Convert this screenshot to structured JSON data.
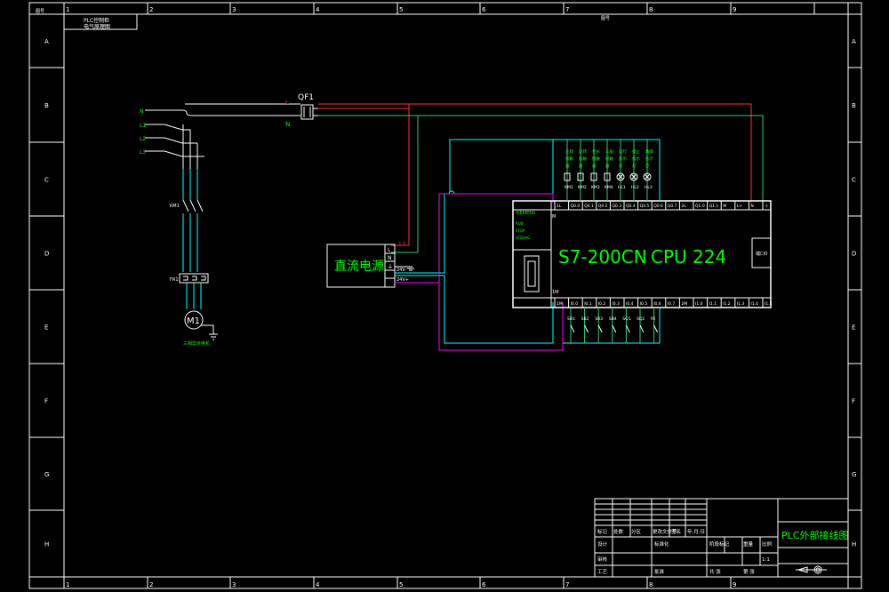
{
  "frame": {
    "top_cols": [
      "1",
      "2",
      "3",
      "4",
      "5",
      "6",
      "7",
      "8",
      "9"
    ],
    "rows": [
      "A",
      "B",
      "C",
      "D",
      "E",
      "F",
      "G",
      "H"
    ],
    "corner_tl": "图号",
    "corner_tr": "图号"
  },
  "title_box": {
    "line1": "PLC控制柜",
    "line2": "电气原理图"
  },
  "supply": {
    "phases": [
      "N",
      "L1",
      "L2",
      "L3"
    ],
    "breaker": "QF1",
    "l_label": "L",
    "n_label": "N"
  },
  "motor": {
    "km_label": "KM1",
    "fr_label": "FR1",
    "symbol": "M1",
    "caption": "三相异步电机"
  },
  "dc_supply": {
    "title": "直流电源",
    "terminals": [
      "L",
      "N",
      "⏚",
      "24V-",
      "24V+"
    ],
    "plus_label": "L1"
  },
  "plc": {
    "model": "S7-200CN",
    "cpu": "CPU 224",
    "status_lines": [
      "SIEMENS",
      "RUN",
      "STOP",
      "SF/DIAG"
    ],
    "port_label": "端口0",
    "output_terms": [
      "1L",
      "Q0.0",
      "Q0.1",
      "Q0.2",
      "Q0.3",
      "Q0.4",
      "Q0.5",
      "Q0.6",
      "Q0.7",
      "2L",
      "Q1.0",
      "Q1.1",
      "M",
      "L+",
      "N",
      "⏚"
    ],
    "input_terms": [
      "1M",
      "I0.0",
      "I0.1",
      "I0.2",
      "I0.3",
      "I0.4",
      "I0.5",
      "I0.6",
      "I0.7",
      "2M",
      "I1.0",
      "I1.1",
      "I1.2",
      "I1.3",
      "I1.4",
      "I1.5"
    ],
    "io_left": "M",
    "io_left_bottom": "1M"
  },
  "outputs": {
    "labels": [
      "正转接触器",
      "反转接触器",
      "星形接触器",
      "三角接触器",
      "运行指示灯",
      "停止指示灯",
      "故障指示灯"
    ],
    "codes": [
      "KM1",
      "KM2",
      "KM3",
      "KM4",
      "HL1",
      "HL2",
      "HL3"
    ]
  },
  "inputs": {
    "labels": [
      "SB1",
      "SB2",
      "SB3",
      "SB4",
      "SQ1",
      "SQ2",
      "FR"
    ]
  },
  "title_block": {
    "drawing_title": "PLC外部接线图",
    "rows": [
      [
        "标记",
        "处数",
        "分区",
        "更改文件号",
        "签名",
        "年.月.日"
      ],
      [
        "设计",
        "",
        "标准化",
        "",
        "阶段标记",
        "重量",
        "比例"
      ],
      [
        "审核",
        "",
        "",
        "",
        "",
        "",
        "1:1"
      ],
      [
        "工艺",
        "",
        "批准",
        "",
        "共 张",
        "第 张"
      ]
    ]
  }
}
